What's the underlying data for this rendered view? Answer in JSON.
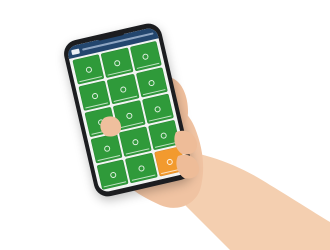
{
  "scene": "hand-holding-phone",
  "colors": {
    "background": "#ffffff",
    "phone_body": "#1c1d20",
    "app_header": "#23466e",
    "tile_ok": "#2f9a3a",
    "tile_warning": "#f29a2e"
  },
  "app": {
    "tiles": [
      {
        "status": "ok"
      },
      {
        "status": "ok"
      },
      {
        "status": "ok"
      },
      {
        "status": "ok"
      },
      {
        "status": "ok"
      },
      {
        "status": "ok"
      },
      {
        "status": "ok"
      },
      {
        "status": "ok"
      },
      {
        "status": "ok"
      },
      {
        "status": "ok"
      },
      {
        "status": "ok"
      },
      {
        "status": "ok"
      },
      {
        "status": "ok"
      },
      {
        "status": "ok"
      },
      {
        "status": "warning"
      }
    ]
  }
}
